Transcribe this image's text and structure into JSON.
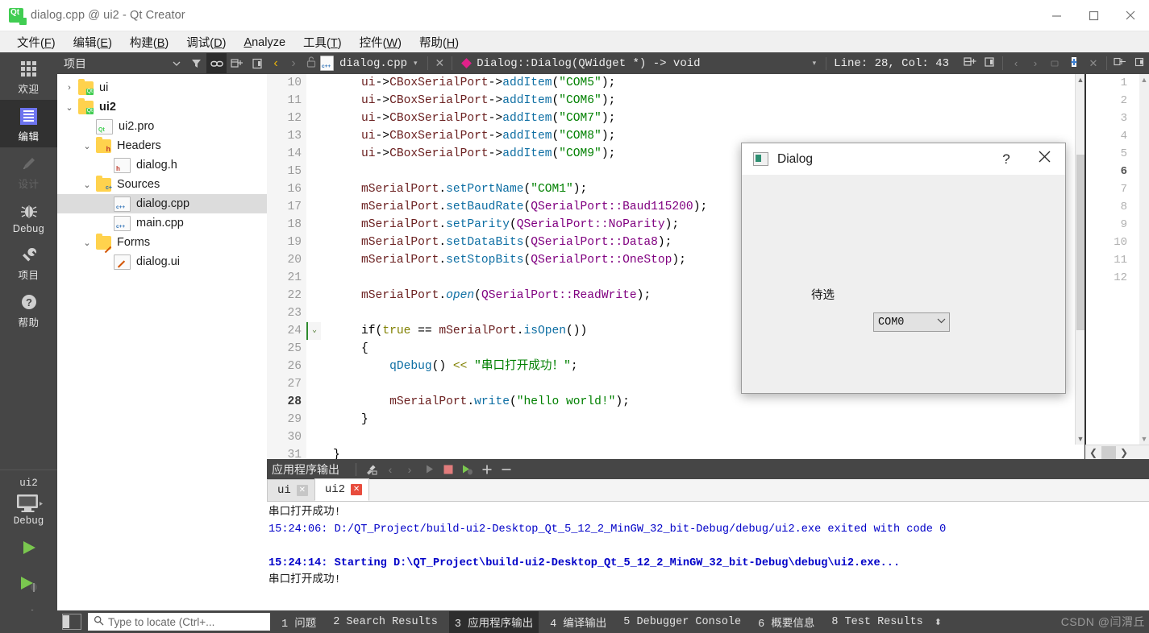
{
  "window": {
    "title": "dialog.cpp @ ui2 - Qt Creator",
    "logo": "qt-logo",
    "minimize": "–",
    "maximize": "□",
    "close": "✕"
  },
  "menubar": [
    {
      "label": "文件(F)",
      "mnemonic": "F"
    },
    {
      "label": "编辑(E)",
      "mnemonic": "E"
    },
    {
      "label": "构建(B)",
      "mnemonic": "B"
    },
    {
      "label": "调试(D)",
      "mnemonic": "D"
    },
    {
      "label": "Analyze",
      "mnemonic": "A"
    },
    {
      "label": "工具(T)",
      "mnemonic": "T"
    },
    {
      "label": "控件(W)",
      "mnemonic": "W"
    },
    {
      "label": "帮助(H)",
      "mnemonic": "H"
    }
  ],
  "modebar": {
    "modes": [
      {
        "label": "欢迎",
        "icon": "grid-icon",
        "state": "normal"
      },
      {
        "label": "编辑",
        "icon": "document-lines-icon",
        "state": "active"
      },
      {
        "label": "设计",
        "icon": "pencil-icon",
        "state": "disabled"
      },
      {
        "label": "Debug",
        "icon": "bug-icon",
        "state": "normal"
      },
      {
        "label": "项目",
        "icon": "wrench-icon",
        "state": "normal"
      },
      {
        "label": "帮助",
        "icon": "question-circle-icon",
        "state": "normal"
      }
    ],
    "kit": {
      "project": "ui2",
      "target_icon": "desktop-icon",
      "build_config": "Debug",
      "run_button": "run-icon",
      "debug_button": "run-debug-icon",
      "build_button": "hammer-icon"
    }
  },
  "project_panel": {
    "title": "项目",
    "toolbar": [
      "chevron-down-icon",
      "filter-icon",
      "link-icon",
      "collapse-all-icon",
      "sync-icon"
    ],
    "tree": [
      {
        "label": "ui",
        "icon": "qt-folder-icon",
        "indent": 0,
        "twisty": "collapsed",
        "bold": false,
        "selected": false
      },
      {
        "label": "ui2",
        "icon": "qt-folder-icon",
        "indent": 0,
        "twisty": "expanded",
        "bold": true,
        "selected": false
      },
      {
        "label": "ui2.pro",
        "icon": "pro-file-icon",
        "indent": 1,
        "twisty": "none",
        "bold": false,
        "selected": false
      },
      {
        "label": "Headers",
        "icon": "h-folder-icon",
        "indent": 1,
        "twisty": "expanded",
        "bold": false,
        "selected": false
      },
      {
        "label": "dialog.h",
        "icon": "h-file-icon",
        "indent": 2,
        "twisty": "none",
        "bold": false,
        "selected": false
      },
      {
        "label": "Sources",
        "icon": "cpp-folder-icon",
        "indent": 1,
        "twisty": "expanded",
        "bold": false,
        "selected": false
      },
      {
        "label": "dialog.cpp",
        "icon": "cpp-file-icon",
        "indent": 2,
        "twisty": "none",
        "bold": false,
        "selected": true
      },
      {
        "label": "main.cpp",
        "icon": "cpp-file-icon",
        "indent": 2,
        "twisty": "none",
        "bold": false,
        "selected": false
      },
      {
        "label": "Forms",
        "icon": "ui-folder-icon",
        "indent": 1,
        "twisty": "expanded",
        "bold": false,
        "selected": false
      },
      {
        "label": "dialog.ui",
        "icon": "ui-file-icon",
        "indent": 2,
        "twisty": "none",
        "bold": false,
        "selected": false
      }
    ]
  },
  "editor_toolbar": {
    "back": "◀",
    "forward": "▶",
    "lock": "lock-open-icon",
    "filename": "dialog.cpp",
    "file_dropdown": "▾",
    "close_file": "✕",
    "symbol": "Dialog::Dialog(QWidget *) -> void",
    "symbol_dropdown": "▾",
    "line_col": "Line: 28, Col: 43",
    "split_icon": "split-horizontal-icon",
    "close_split_icon": "close-split-icon"
  },
  "editor": {
    "current_line": 28,
    "lines": [
      {
        "n": 10,
        "fold": "",
        "segments": [
          {
            "t": "    ",
            "c": ""
          },
          {
            "t": "ui",
            "c": "k-var"
          },
          {
            "t": "->",
            "c": "k-op"
          },
          {
            "t": "CBoxSerialPort",
            "c": "k-var"
          },
          {
            "t": "->",
            "c": "k-op"
          },
          {
            "t": "addItem",
            "c": "k-fn"
          },
          {
            "t": "(",
            "c": "k-op"
          },
          {
            "t": "\"COM5\"",
            "c": "k-str"
          },
          {
            "t": ");",
            "c": "k-op"
          }
        ]
      },
      {
        "n": 11,
        "fold": "",
        "segments": [
          {
            "t": "    ",
            "c": ""
          },
          {
            "t": "ui",
            "c": "k-var"
          },
          {
            "t": "->",
            "c": "k-op"
          },
          {
            "t": "CBoxSerialPort",
            "c": "k-var"
          },
          {
            "t": "->",
            "c": "k-op"
          },
          {
            "t": "addItem",
            "c": "k-fn"
          },
          {
            "t": "(",
            "c": "k-op"
          },
          {
            "t": "\"COM6\"",
            "c": "k-str"
          },
          {
            "t": ");",
            "c": "k-op"
          }
        ]
      },
      {
        "n": 12,
        "fold": "",
        "segments": [
          {
            "t": "    ",
            "c": ""
          },
          {
            "t": "ui",
            "c": "k-var"
          },
          {
            "t": "->",
            "c": "k-op"
          },
          {
            "t": "CBoxSerialPort",
            "c": "k-var"
          },
          {
            "t": "->",
            "c": "k-op"
          },
          {
            "t": "addItem",
            "c": "k-fn"
          },
          {
            "t": "(",
            "c": "k-op"
          },
          {
            "t": "\"COM7\"",
            "c": "k-str"
          },
          {
            "t": ");",
            "c": "k-op"
          }
        ]
      },
      {
        "n": 13,
        "fold": "",
        "segments": [
          {
            "t": "    ",
            "c": ""
          },
          {
            "t": "ui",
            "c": "k-var"
          },
          {
            "t": "->",
            "c": "k-op"
          },
          {
            "t": "CBoxSerialPort",
            "c": "k-var"
          },
          {
            "t": "->",
            "c": "k-op"
          },
          {
            "t": "addItem",
            "c": "k-fn"
          },
          {
            "t": "(",
            "c": "k-op"
          },
          {
            "t": "\"COM8\"",
            "c": "k-str"
          },
          {
            "t": ");",
            "c": "k-op"
          }
        ]
      },
      {
        "n": 14,
        "fold": "",
        "segments": [
          {
            "t": "    ",
            "c": ""
          },
          {
            "t": "ui",
            "c": "k-var"
          },
          {
            "t": "->",
            "c": "k-op"
          },
          {
            "t": "CBoxSerialPort",
            "c": "k-var"
          },
          {
            "t": "->",
            "c": "k-op"
          },
          {
            "t": "addItem",
            "c": "k-fn"
          },
          {
            "t": "(",
            "c": "k-op"
          },
          {
            "t": "\"COM9\"",
            "c": "k-str"
          },
          {
            "t": ");",
            "c": "k-op"
          }
        ]
      },
      {
        "n": 15,
        "fold": "",
        "segments": []
      },
      {
        "n": 16,
        "fold": "",
        "segments": [
          {
            "t": "    ",
            "c": ""
          },
          {
            "t": "mSerialPort",
            "c": "k-var"
          },
          {
            "t": ".",
            "c": "k-op"
          },
          {
            "t": "setPortName",
            "c": "k-fn"
          },
          {
            "t": "(",
            "c": "k-op"
          },
          {
            "t": "\"COM1\"",
            "c": "k-str"
          },
          {
            "t": ");",
            "c": "k-op"
          }
        ]
      },
      {
        "n": 17,
        "fold": "",
        "segments": [
          {
            "t": "    ",
            "c": ""
          },
          {
            "t": "mSerialPort",
            "c": "k-var"
          },
          {
            "t": ".",
            "c": "k-op"
          },
          {
            "t": "setBaudRate",
            "c": "k-fn"
          },
          {
            "t": "(",
            "c": "k-op"
          },
          {
            "t": "QSerialPort::Baud115200",
            "c": "k-type"
          },
          {
            "t": ");",
            "c": "k-op"
          }
        ]
      },
      {
        "n": 18,
        "fold": "",
        "segments": [
          {
            "t": "    ",
            "c": ""
          },
          {
            "t": "mSerialPort",
            "c": "k-var"
          },
          {
            "t": ".",
            "c": "k-op"
          },
          {
            "t": "setParity",
            "c": "k-fn"
          },
          {
            "t": "(",
            "c": "k-op"
          },
          {
            "t": "QSerialPort::NoParity",
            "c": "k-type"
          },
          {
            "t": ");",
            "c": "k-op"
          }
        ]
      },
      {
        "n": 19,
        "fold": "",
        "segments": [
          {
            "t": "    ",
            "c": ""
          },
          {
            "t": "mSerialPort",
            "c": "k-var"
          },
          {
            "t": ".",
            "c": "k-op"
          },
          {
            "t": "setDataBits",
            "c": "k-fn"
          },
          {
            "t": "(",
            "c": "k-op"
          },
          {
            "t": "QSerialPort::Data8",
            "c": "k-type"
          },
          {
            "t": ");",
            "c": "k-op"
          }
        ]
      },
      {
        "n": 20,
        "fold": "",
        "segments": [
          {
            "t": "    ",
            "c": ""
          },
          {
            "t": "mSerialPort",
            "c": "k-var"
          },
          {
            "t": ".",
            "c": "k-op"
          },
          {
            "t": "setStopBits",
            "c": "k-fn"
          },
          {
            "t": "(",
            "c": "k-op"
          },
          {
            "t": "QSerialPort::OneStop",
            "c": "k-type"
          },
          {
            "t": ");",
            "c": "k-op"
          }
        ]
      },
      {
        "n": 21,
        "fold": "",
        "segments": []
      },
      {
        "n": 22,
        "fold": "",
        "segments": [
          {
            "t": "    ",
            "c": ""
          },
          {
            "t": "mSerialPort",
            "c": "k-var"
          },
          {
            "t": ".",
            "c": "k-op"
          },
          {
            "t": "open",
            "c": "k-italic"
          },
          {
            "t": "(",
            "c": "k-op"
          },
          {
            "t": "QSerialPort::ReadWrite",
            "c": "k-type"
          },
          {
            "t": ");",
            "c": "k-op"
          }
        ]
      },
      {
        "n": 23,
        "fold": "",
        "segments": []
      },
      {
        "n": 24,
        "fold": "v",
        "segments": [
          {
            "t": "    ",
            "c": ""
          },
          {
            "t": "if",
            "c": "k-op"
          },
          {
            "t": "(",
            "c": "k-op"
          },
          {
            "t": "true",
            "c": "k-kw"
          },
          {
            "t": " == ",
            "c": "k-op"
          },
          {
            "t": "mSerialPort",
            "c": "k-var"
          },
          {
            "t": ".",
            "c": "k-op"
          },
          {
            "t": "isOpen",
            "c": "k-fn"
          },
          {
            "t": "())",
            "c": "k-op"
          }
        ]
      },
      {
        "n": 25,
        "fold": "",
        "segments": [
          {
            "t": "    {",
            "c": "k-op"
          }
        ]
      },
      {
        "n": 26,
        "fold": "",
        "segments": [
          {
            "t": "        ",
            "c": ""
          },
          {
            "t": "qDebug",
            "c": "k-fn"
          },
          {
            "t": "() ",
            "c": "k-op"
          },
          {
            "t": "<< ",
            "c": "k-kw"
          },
          {
            "t": "\"串口打开成功！\"",
            "c": "k-str"
          },
          {
            "t": ";",
            "c": "k-op"
          }
        ]
      },
      {
        "n": 27,
        "fold": "",
        "segments": []
      },
      {
        "n": 28,
        "fold": "",
        "segments": [
          {
            "t": "        ",
            "c": ""
          },
          {
            "t": "mSerialPort",
            "c": "k-var"
          },
          {
            "t": ".",
            "c": "k-op"
          },
          {
            "t": "write",
            "c": "k-fn"
          },
          {
            "t": "(",
            "c": "k-op"
          },
          {
            "t": "\"hello world!\"",
            "c": "k-str"
          },
          {
            "t": ");",
            "c": "k-op"
          }
        ]
      },
      {
        "n": 29,
        "fold": "",
        "segments": [
          {
            "t": "    }",
            "c": "k-op"
          }
        ]
      },
      {
        "n": 30,
        "fold": "",
        "segments": []
      },
      {
        "n": 31,
        "fold": "",
        "segments": [
          {
            "t": "}",
            "c": "k-op"
          }
        ]
      }
    ]
  },
  "second_pane": {
    "current_line": 6,
    "line_numbers": [
      1,
      2,
      3,
      4,
      5,
      6,
      7,
      8,
      9,
      10,
      11,
      12
    ]
  },
  "output_pane": {
    "title": "应用程序输出",
    "toolbar": [
      "clear-icon",
      "prev-icon",
      "next-icon",
      "play-icon",
      "stop-icon",
      "run-debug-icon",
      "zoom-in-icon",
      "zoom-out-icon"
    ],
    "tabs": [
      {
        "label": "ui",
        "active": false,
        "close": "✕"
      },
      {
        "label": "ui2",
        "active": true,
        "close": "✕"
      }
    ],
    "lines": [
      {
        "text": "串口打开成功!",
        "style": "plain"
      },
      {
        "text": "15:24:06: D:/QT_Project/build-ui2-Desktop_Qt_5_12_2_MinGW_32_bit-Debug/debug/ui2.exe exited with code 0",
        "style": "blue"
      },
      {
        "text": "",
        "style": "plain"
      },
      {
        "text": "15:24:14: Starting D:\\QT_Project\\build-ui2-Desktop_Qt_5_12_2_MinGW_32_bit-Debug\\debug\\ui2.exe...",
        "style": "bold-blue"
      },
      {
        "text": "串口打开成功!",
        "style": "plain"
      }
    ]
  },
  "statusbar": {
    "sidebar_toggle": "sidebar-toggle-icon",
    "locate_placeholder": "Type to locate (Ctrl+...",
    "items": [
      {
        "num": "1",
        "label": "问题",
        "selected": false
      },
      {
        "num": "2",
        "label": "Search Results",
        "selected": false
      },
      {
        "num": "3",
        "label": "应用程序输出",
        "selected": true
      },
      {
        "num": "4",
        "label": "编译输出",
        "selected": false
      },
      {
        "num": "5",
        "label": "Debugger Console",
        "selected": false
      },
      {
        "num": "6",
        "label": "概要信息",
        "selected": false
      },
      {
        "num": "8",
        "label": "Test Results",
        "selected": false
      }
    ],
    "updown": "⬍",
    "watermark": "CSDN @闫渭丘"
  },
  "dialog": {
    "icon": "app-window-icon",
    "title": "Dialog",
    "help_button": "?",
    "close_button": "✕",
    "label": "待选",
    "combo_value": "COM0",
    "combo_arrow": "⌄"
  },
  "colors": {
    "accent": "#41cd52",
    "chrome_dark": "#464646",
    "chrome_darker": "#2d2d2d",
    "selection": "#dcdcdc",
    "output_blue": "#0000c8",
    "string_green": "#008000",
    "type_purple": "#800080",
    "func_blue": "#0d6ea3"
  }
}
